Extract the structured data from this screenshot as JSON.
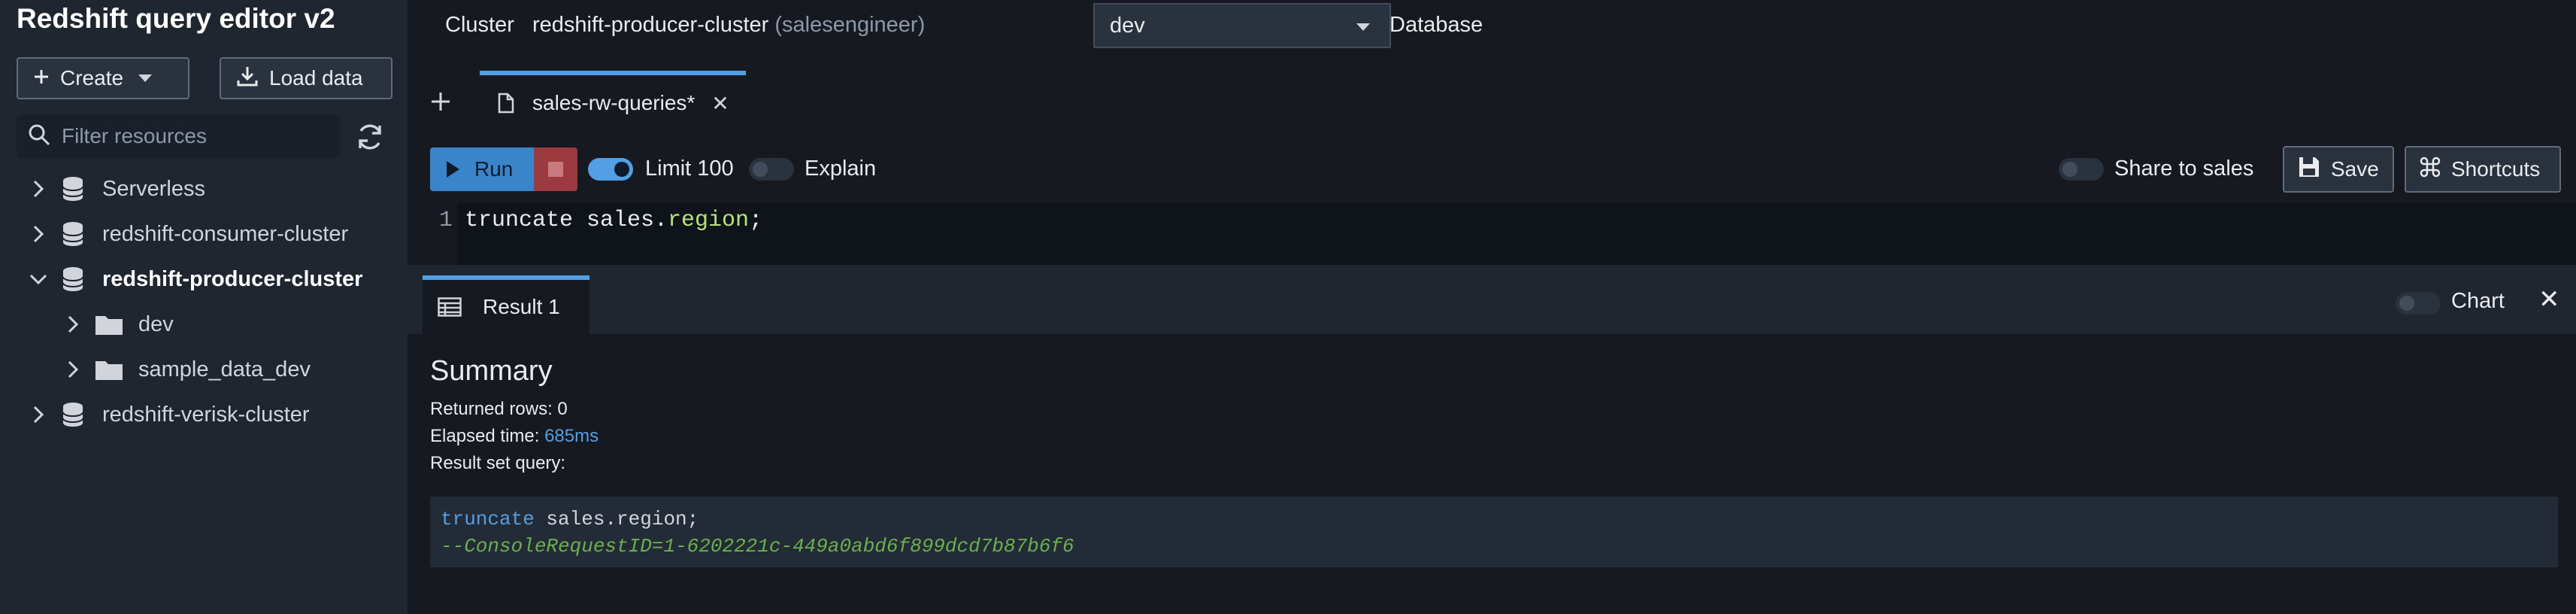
{
  "sidebar": {
    "title": "Redshift query editor v2",
    "create_label": "Create",
    "load_label": "Load data",
    "filter_placeholder": "Filter resources",
    "tree": [
      {
        "label": "Serverless"
      },
      {
        "label": "redshift-consumer-cluster"
      },
      {
        "label": "redshift-producer-cluster"
      },
      {
        "label": "dev"
      },
      {
        "label": "sample_data_dev"
      },
      {
        "label": "redshift-verisk-cluster"
      }
    ]
  },
  "topbar": {
    "cluster_label": "Cluster",
    "cluster_value": "redshift-producer-cluster",
    "cluster_user": "(salesengineer)",
    "database_label": "Database",
    "database_value": "dev"
  },
  "tabs": [
    {
      "label": "sales-rw-queries*"
    }
  ],
  "toolbar": {
    "run_label": "Run",
    "limit_label": "Limit 100",
    "explain_label": "Explain",
    "share_label": "Share to sales",
    "save_label": "Save",
    "shortcuts_label": "Shortcuts"
  },
  "editor": {
    "line_number": "1",
    "code_prefix": "truncate sales.",
    "code_identifier": "region",
    "code_suffix": ";"
  },
  "result": {
    "tab_label": "Result 1",
    "chart_label": "Chart",
    "summary_title": "Summary",
    "returned_rows_label": "Returned rows: 0",
    "elapsed_label": "Elapsed time: ",
    "elapsed_value": "685ms",
    "result_query_label": "Result set query:",
    "query_keyword": "truncate",
    "query_rest": " sales.region;",
    "query_comment": "--ConsoleRequestID=1-6202221c-449a0abd6f899dcd7b87b6f6"
  },
  "colors": {
    "accent": "#539fe5",
    "stop": "#9b3b3f",
    "background": "#16191f"
  }
}
